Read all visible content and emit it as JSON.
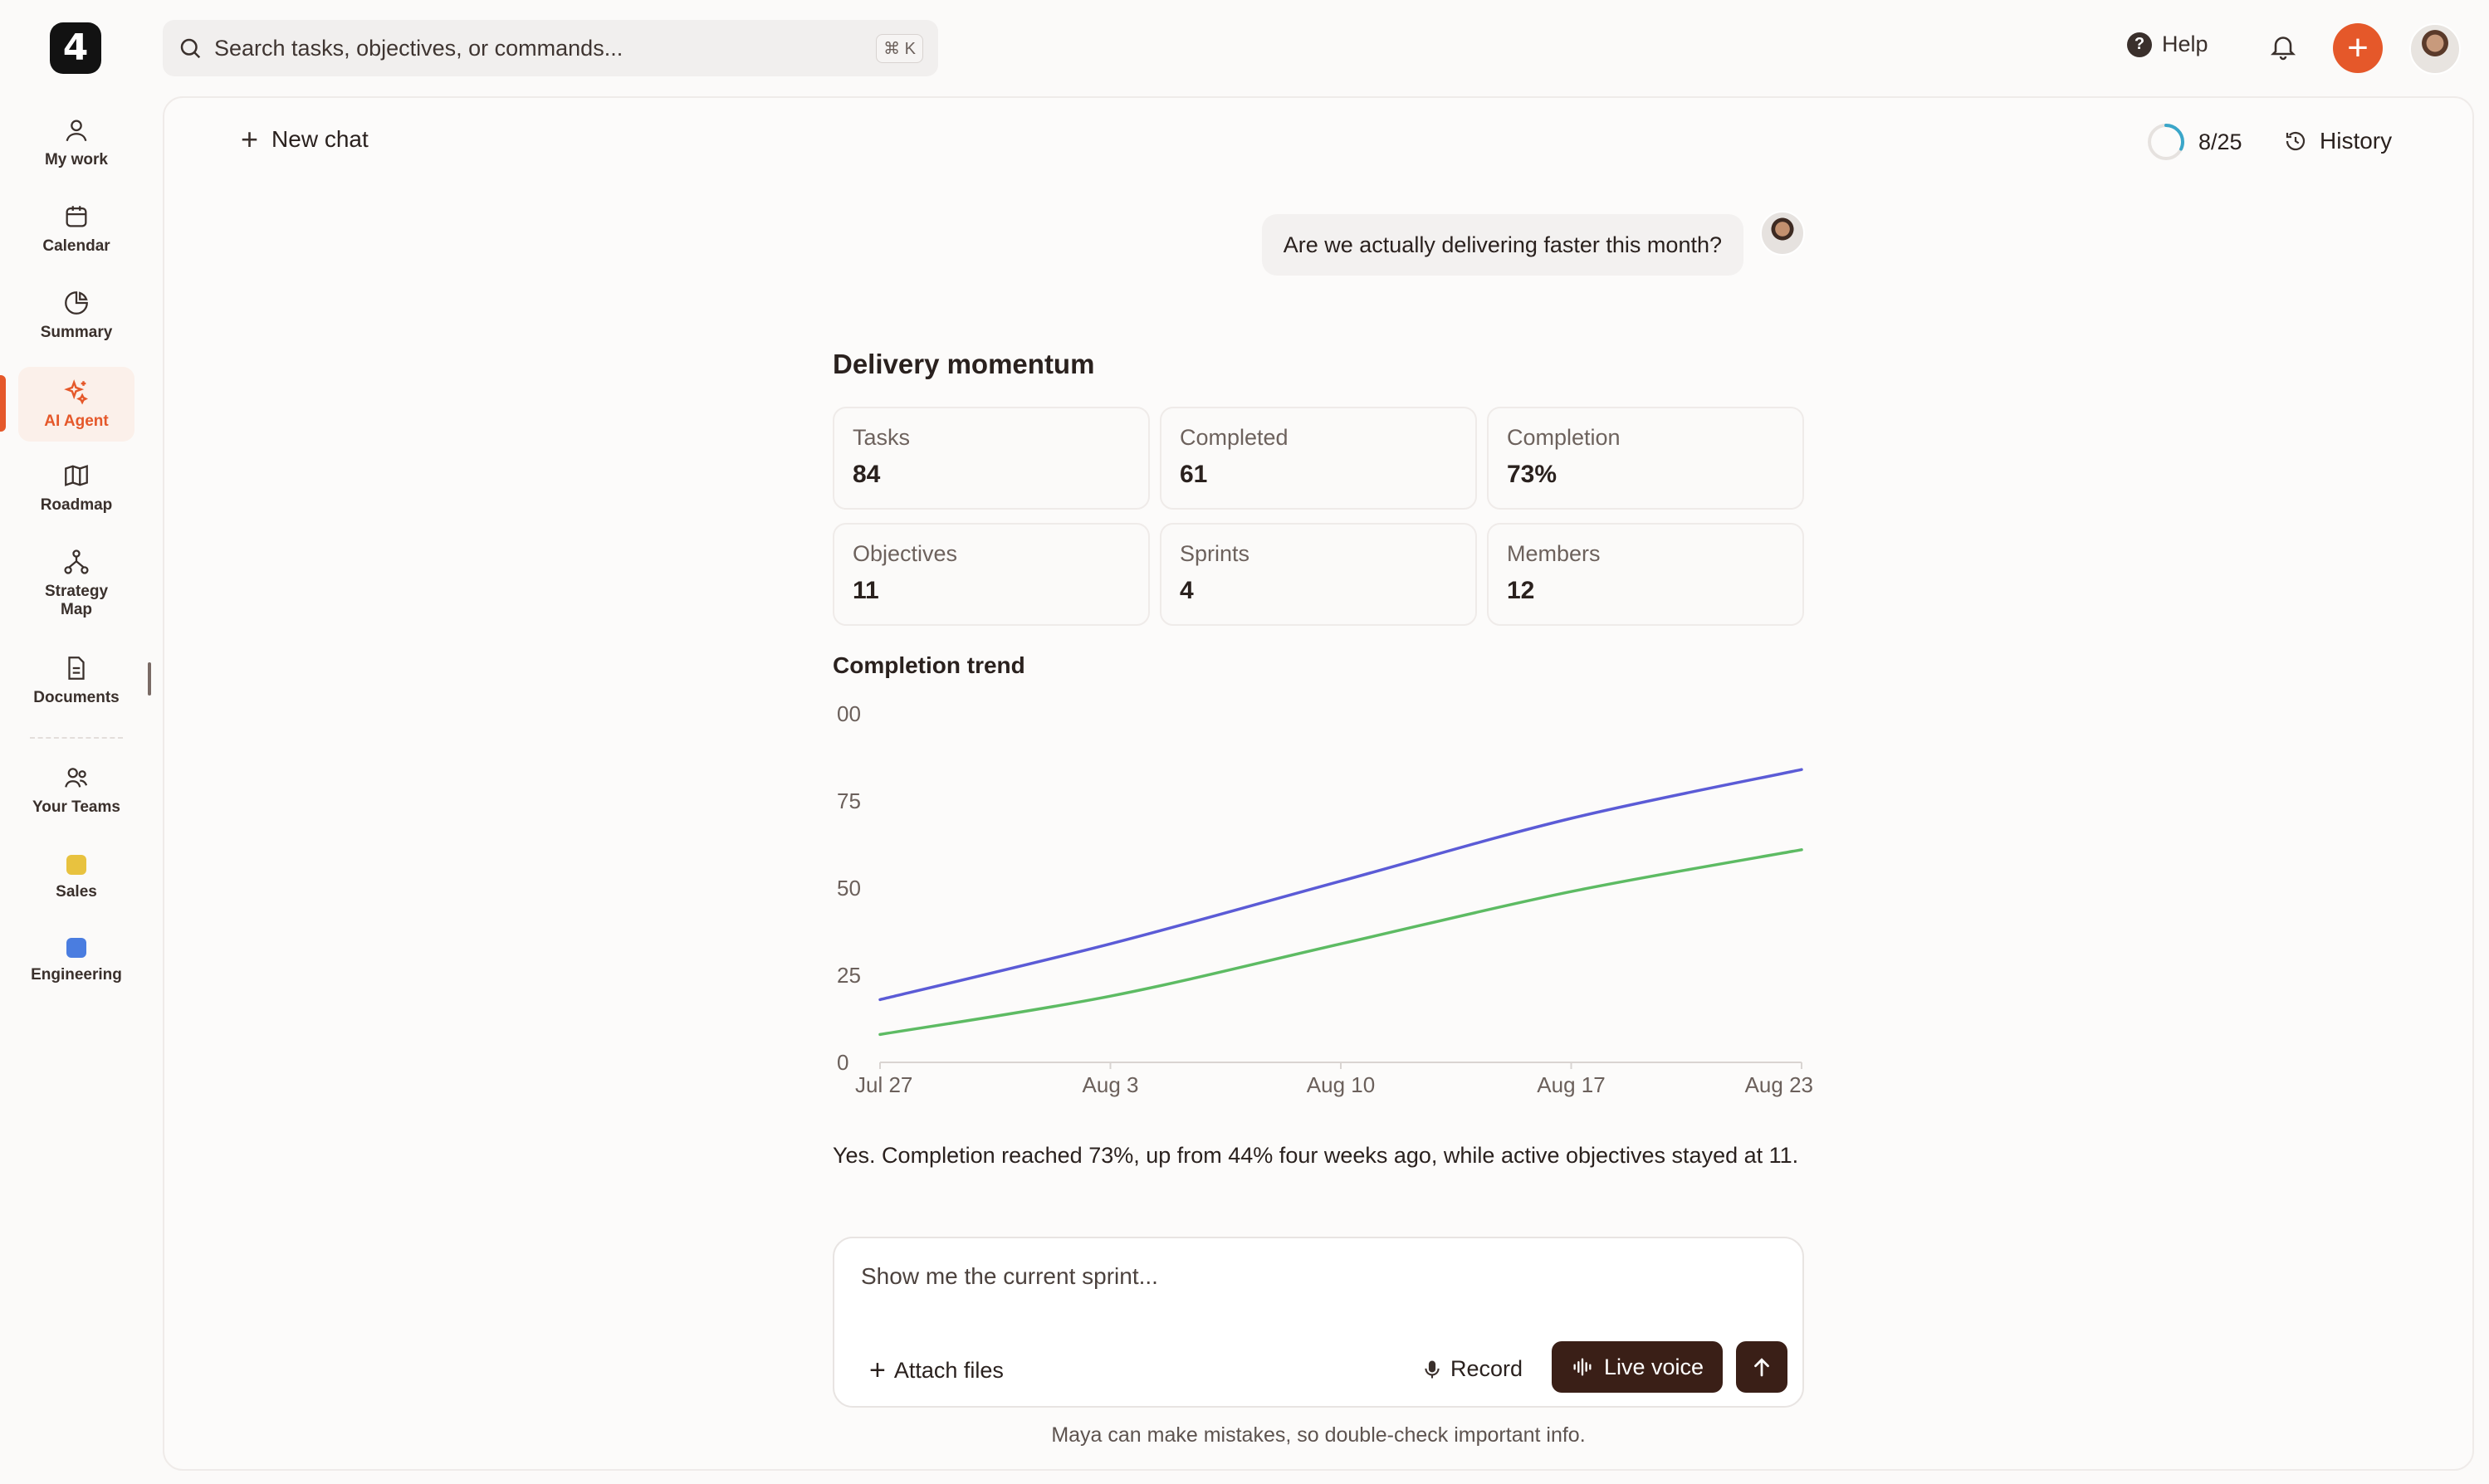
{
  "app": {
    "logo_text": "4"
  },
  "search": {
    "placeholder": "Search tasks, objectives, or commands...",
    "shortcut": "⌘ K"
  },
  "topbar": {
    "help_label": "Help"
  },
  "sidebar": {
    "items": [
      {
        "label": "My work",
        "icon": "user-icon"
      },
      {
        "label": "Calendar",
        "icon": "calendar-icon"
      },
      {
        "label": "Summary",
        "icon": "pie-chart-icon"
      },
      {
        "label": "AI Agent",
        "icon": "sparkle-icon",
        "active": true
      },
      {
        "label": "Roadmap",
        "icon": "map-icon"
      },
      {
        "label": "Strategy Map",
        "icon": "hierarchy-icon"
      },
      {
        "label": "Documents",
        "icon": "document-icon"
      },
      {
        "label": "Your Teams",
        "icon": "users-icon"
      }
    ],
    "teams": [
      {
        "label": "Sales",
        "color": "#e8c23f"
      },
      {
        "label": "Engineering",
        "color": "#4a7de0"
      }
    ],
    "accent_color": "#e5582a"
  },
  "chat": {
    "new_chat_label": "New chat",
    "usage": "8/25",
    "usage_fraction": 0.32,
    "history_label": "History",
    "user_message": "Are we actually delivering faster this month?",
    "response": {
      "title": "Delivery momentum",
      "stats": [
        {
          "label": "Tasks",
          "value": "84"
        },
        {
          "label": "Completed",
          "value": "61"
        },
        {
          "label": "Completion",
          "value": "73%"
        },
        {
          "label": "Objectives",
          "value": "11"
        },
        {
          "label": "Sprints",
          "value": "4"
        },
        {
          "label": "Members",
          "value": "12"
        }
      ],
      "trend_title": "Completion trend",
      "answer": "Yes. Completion reached 73%, up from 44% four weeks ago, while active objectives stayed at 11."
    }
  },
  "chart_data": {
    "type": "line",
    "x": [
      "Jul 27",
      "Aug 3",
      "Aug 10",
      "Aug 17",
      "Aug 23"
    ],
    "y_ticks": [
      "00",
      "75",
      "50",
      "25",
      "0"
    ],
    "ylim": [
      0,
      100
    ],
    "grid": false,
    "series": [
      {
        "color": "#5b5bd6",
        "values": [
          18,
          34,
          52,
          70,
          84
        ]
      },
      {
        "color": "#5dbb63",
        "values": [
          8,
          19,
          34,
          49,
          61
        ]
      }
    ]
  },
  "composer": {
    "placeholder": "Show me the current sprint...",
    "attach_label": "Attach files",
    "record_label": "Record",
    "live_voice_label": "Live voice",
    "disclaimer": "Maya can make mistakes, so double-check important info."
  }
}
